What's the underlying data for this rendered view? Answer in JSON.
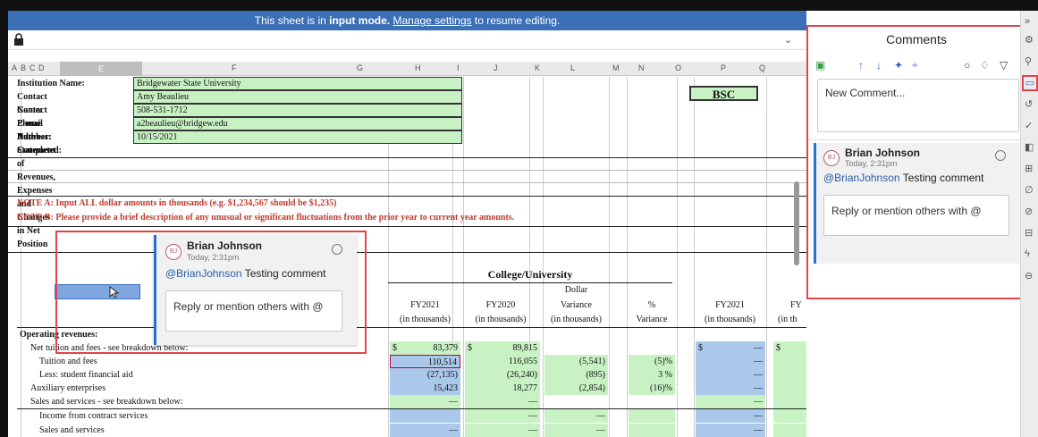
{
  "banner": {
    "prefix": "This sheet is in ",
    "mode": "input mode.",
    "link": "Manage settings",
    "suffix": " to resume editing."
  },
  "columns": [
    "A",
    "B",
    "C",
    "D",
    "E",
    "F",
    "G",
    "H",
    "I",
    "J",
    "K",
    "L",
    "M",
    "N",
    "O",
    "P",
    "Q"
  ],
  "info": {
    "institution_label": "Institution Name:",
    "institution_value": "Bridgewater State University",
    "contact_label": "Contact Name:",
    "contact_value": "Amy Beaulieu",
    "phone_label": "Contact Phone Number:",
    "phone_value": "508-531-1712",
    "email_label": "E-mail Address:",
    "email_value": "a2beaulieu@bridgew.edu",
    "date_label": "Date Completed:",
    "date_value": "10/15/2021",
    "statement": "Statement of Revenues, Expenses and Changes in Net Position",
    "code": "BSC"
  },
  "notes": {
    "a": "NOTE A:  Input ALL dollar amounts in thousands (e.g. $1,234,567 should be $1,235)",
    "b": "NOTE B:  Please provide a brief description of any unusual or significant fluctuations from the prior year to current year amounts."
  },
  "table": {
    "group_title": "College/University",
    "headers": {
      "dollar": "Dollar",
      "fy2021": "FY2021",
      "fy2020": "FY2020",
      "variance": "Variance",
      "pct": "%",
      "fy2021b": "FY2021",
      "fyb": "FY",
      "thous": "(in thousands)",
      "variance_sub": "Variance",
      "inth": "(in th"
    },
    "section": "Operating revenues:",
    "rows": [
      {
        "label": "Net tuition and fees - see breakdown below:",
        "dollar1": "$",
        "h": "83,379",
        "dollar2": "$",
        "j": "89,815",
        "l": "",
        "n": "",
        "p_dollar": "$",
        "p": "—",
        "q_dollar": "$"
      },
      {
        "label": "Tuition and fees",
        "h": "110,514",
        "j": "116,055",
        "l": "(5,541)",
        "n": "(5)%",
        "p": "—"
      },
      {
        "label": "Less: student financial aid",
        "h": "(27,135)",
        "j": "(26,240)",
        "l": "(895)",
        "n": "3 %",
        "p": "—"
      },
      {
        "label": "Auxiliary enterprises",
        "h": "15,423",
        "j": "18,277",
        "l": "(2,854)",
        "n": "(16)%",
        "p": "—"
      },
      {
        "label": "Sales and services - see breakdown below:",
        "h": "—",
        "j": "—",
        "l": "",
        "n": "",
        "p": "—"
      },
      {
        "label": "Income from contract services",
        "h": "",
        "j": "—",
        "l": "—",
        "n": "",
        "p": "—"
      },
      {
        "label": "Sales and services",
        "h": "—",
        "j": "—",
        "l": "—",
        "n": "",
        "p": "—"
      }
    ]
  },
  "popup": {
    "initials": "BJ",
    "name": "Brian Johnson",
    "time": "Today, 2:31pm",
    "mention": "@BrianJohnson",
    "text": " Testing comment",
    "reply_placeholder": "Reply or mention others with @"
  },
  "panel": {
    "title": "Comments",
    "new_comment": "New Comment...",
    "comment": {
      "initials": "BJ",
      "name": "Brian Johnson",
      "time": "Today, 2:31pm",
      "mention": "@BrianJohnson",
      "text": " Testing comment",
      "reply_placeholder": "Reply or mention others with @"
    }
  },
  "colors": {
    "accent": "#e0454a",
    "banner": "#3b6fb6",
    "green": "#c9f2c4",
    "blue": "#a9c8ea"
  }
}
